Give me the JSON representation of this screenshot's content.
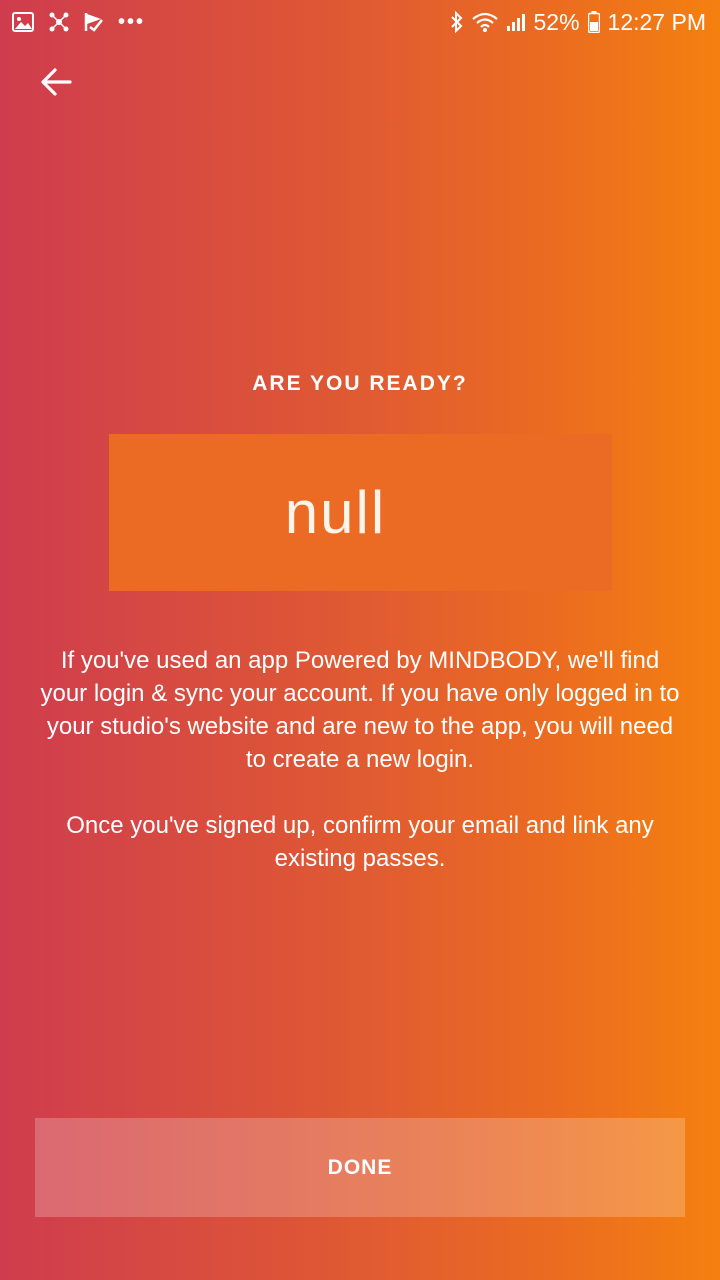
{
  "status_bar": {
    "left_icons": [
      "gallery-icon",
      "app-icon",
      "flag-icon",
      "more-dots-icon"
    ],
    "more_dots": "•••",
    "battery_percent": "52%",
    "time": "12:27 PM"
  },
  "nav": {
    "back_icon": "arrow-left-icon"
  },
  "main": {
    "headline": "ARE YOU READY?",
    "name_value": "null",
    "paragraph_1": "If you've used an app Powered by MINDBODY, we'll find your login & sync your account. If you have only logged in to your studio's website and are new to the app, you will need to create a new login.",
    "paragraph_2": "Once you've signed up, confirm your email and link any existing passes."
  },
  "footer": {
    "done_label": "DONE"
  },
  "colors": {
    "gradient_left": "#cf3c4e",
    "gradient_right": "#f5800f",
    "name_box": "#ec6b24"
  }
}
